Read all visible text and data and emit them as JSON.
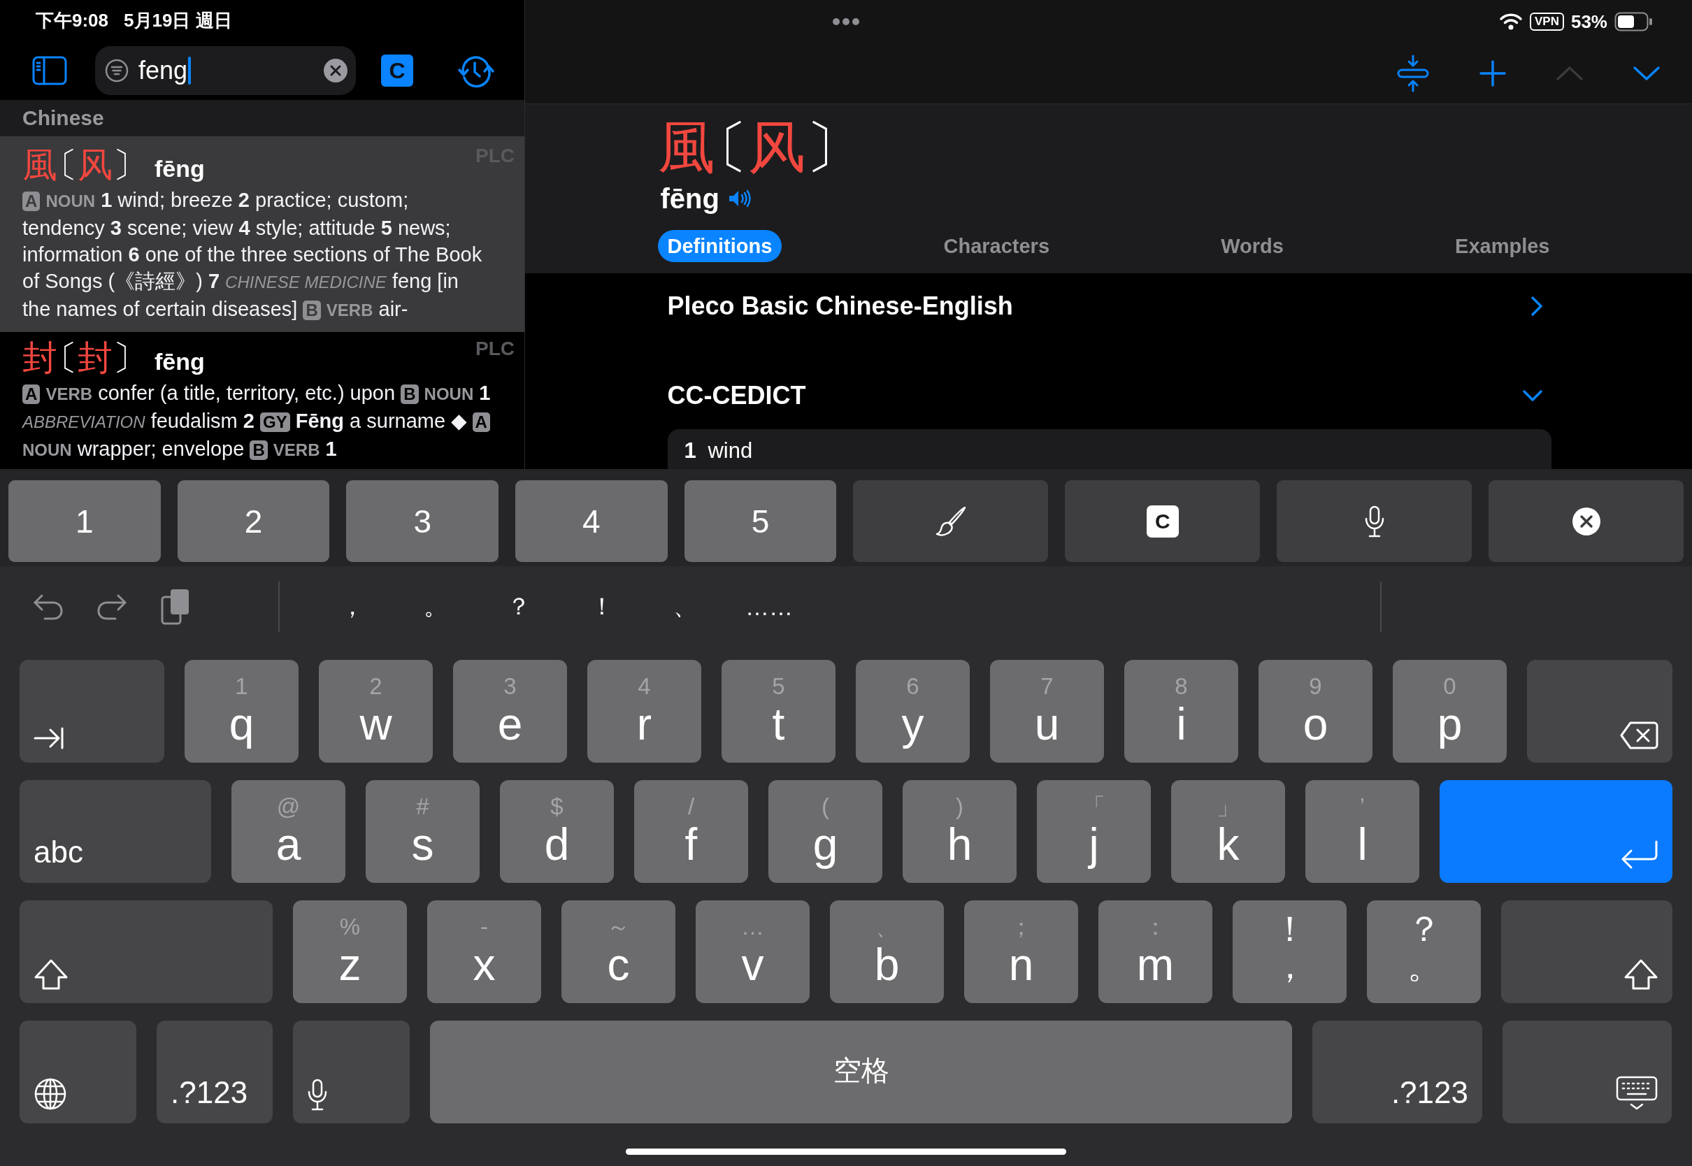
{
  "status_bar": {
    "time": "下午9:08",
    "date": "5月19日 週日",
    "vpn": "VPN",
    "battery": "53%"
  },
  "search_bar": {
    "query": "feng",
    "mode_button": "C"
  },
  "results": {
    "section": "Chinese",
    "items": [
      {
        "selected": true,
        "headword": [
          {
            "kind": "char",
            "text": "風"
          },
          {
            "kind": "bracket",
            "text": "〔"
          },
          {
            "kind": "char",
            "text": "风"
          },
          {
            "kind": "bracket",
            "text": "〕"
          }
        ],
        "pinyin": "fēng",
        "dictionary": "PLC",
        "definition": [
          {
            "kind": "badge",
            "text": "A"
          },
          {
            "kind": "pos",
            "text": "NOUN"
          },
          {
            "kind": "text",
            "text": "**1** wind; breeze **2** practice; custom; tendency **3** scene; view **4** style; attitude **5** news; information **6** one of the three sections of The Book of Songs (《詩經》) **7**"
          },
          {
            "kind": "label",
            "text": "CHINESE MEDICINE"
          },
          {
            "kind": "text",
            "text": "feng [in the names of certain diseases]"
          },
          {
            "kind": "badge",
            "text": "B"
          },
          {
            "kind": "pos",
            "text": "VERB"
          },
          {
            "kind": "text",
            "text": "air-"
          }
        ]
      },
      {
        "selected": false,
        "headword": [
          {
            "kind": "char",
            "text": "封"
          },
          {
            "kind": "bracket",
            "text": "〔"
          },
          {
            "kind": "char",
            "text": "封"
          },
          {
            "kind": "bracket",
            "text": "〕"
          }
        ],
        "pinyin": "fēng",
        "dictionary": "PLC",
        "definition": [
          {
            "kind": "badge",
            "text": "A"
          },
          {
            "kind": "pos",
            "text": "VERB"
          },
          {
            "kind": "text",
            "text": "confer (a title, territory, etc.) upon"
          },
          {
            "kind": "badge",
            "text": "B"
          },
          {
            "kind": "pos",
            "text": "NOUN"
          },
          {
            "kind": "text",
            "text": "**1**"
          },
          {
            "kind": "label",
            "text": "ABBREVIATION"
          },
          {
            "kind": "text",
            "text": "feudalism **2**"
          },
          {
            "kind": "badge",
            "text": "GY"
          },
          {
            "kind": "text",
            "text": "**Fēng** a surname ◆"
          },
          {
            "kind": "badge",
            "text": "A"
          },
          {
            "kind": "pos",
            "text": "NOUN"
          },
          {
            "kind": "text",
            "text": "wrapper; envelope"
          },
          {
            "kind": "badge",
            "text": "B"
          },
          {
            "kind": "pos",
            "text": "VERB"
          },
          {
            "kind": "text",
            "text": "**1**"
          }
        ]
      }
    ]
  },
  "entry": {
    "toolbar": [
      {
        "kind": "collapse",
        "disabled": false
      },
      {
        "kind": "add",
        "disabled": false
      },
      {
        "kind": "previous",
        "disabled": true
      },
      {
        "kind": "next",
        "disabled": false
      }
    ],
    "headword": [
      {
        "kind": "char",
        "text": "風"
      },
      {
        "kind": "bracket",
        "text": "〔"
      },
      {
        "kind": "char",
        "text": "风"
      },
      {
        "kind": "bracket",
        "text": "〕"
      }
    ],
    "pinyin": "fēng",
    "tabs": [
      {
        "label": "Definitions",
        "selected": true
      },
      {
        "label": "Characters",
        "selected": false
      },
      {
        "label": "Words",
        "selected": false
      },
      {
        "label": "Examples",
        "selected": false
      }
    ],
    "dictionaries": [
      {
        "name": "Pleco Basic Chinese-English",
        "expanded": false
      },
      {
        "name": "CC-CEDICT",
        "expanded": true,
        "senses": [
          {
            "number": "1",
            "text": "wind"
          }
        ]
      }
    ]
  },
  "input_bar": [
    {
      "kind": "digit",
      "label": "1"
    },
    {
      "kind": "digit",
      "label": "2"
    },
    {
      "kind": "digit",
      "label": "3"
    },
    {
      "kind": "digit",
      "label": "4"
    },
    {
      "kind": "digit",
      "label": "5"
    },
    {
      "kind": "handwriting"
    },
    {
      "kind": "character_mode",
      "label": "C"
    },
    {
      "kind": "voice"
    },
    {
      "kind": "clear"
    }
  ],
  "shortcut_bar": {
    "actions": [
      {
        "kind": "undo"
      },
      {
        "kind": "redo"
      },
      {
        "kind": "paste"
      }
    ],
    "punctuation": [
      "，",
      "。",
      "？",
      "！",
      "、",
      "……"
    ]
  },
  "keyboard": {
    "rows": [
      {
        "keys": [
          {
            "kind": "tab"
          },
          {
            "kind": "letter",
            "label": "q",
            "hint": "1"
          },
          {
            "kind": "letter",
            "label": "w",
            "hint": "2"
          },
          {
            "kind": "letter",
            "label": "e",
            "hint": "3"
          },
          {
            "kind": "letter",
            "label": "r",
            "hint": "4"
          },
          {
            "kind": "letter",
            "label": "t",
            "hint": "5"
          },
          {
            "kind": "letter",
            "label": "y",
            "hint": "6"
          },
          {
            "kind": "letter",
            "label": "u",
            "hint": "7"
          },
          {
            "kind": "letter",
            "label": "i",
            "hint": "8"
          },
          {
            "kind": "letter",
            "label": "o",
            "hint": "9"
          },
          {
            "kind": "letter",
            "label": "p",
            "hint": "0"
          },
          {
            "kind": "delete"
          }
        ]
      },
      {
        "keys": [
          {
            "kind": "abc",
            "label": "abc"
          },
          {
            "kind": "letter",
            "label": "a",
            "hint": "@"
          },
          {
            "kind": "letter",
            "label": "s",
            "hint": "#"
          },
          {
            "kind": "letter",
            "label": "d",
            "hint": "$"
          },
          {
            "kind": "letter",
            "label": "f",
            "hint": "/"
          },
          {
            "kind": "letter",
            "label": "g",
            "hint": "("
          },
          {
            "kind": "letter",
            "label": "h",
            "hint": ")"
          },
          {
            "kind": "letter",
            "label": "j",
            "hint": "「"
          },
          {
            "kind": "letter",
            "label": "k",
            "hint": "」"
          },
          {
            "kind": "letter",
            "label": "l",
            "hint": "’"
          },
          {
            "kind": "return"
          }
        ]
      },
      {
        "keys": [
          {
            "kind": "shift"
          },
          {
            "kind": "letter",
            "label": "z",
            "hint": "%"
          },
          {
            "kind": "letter",
            "label": "x",
            "hint": "-"
          },
          {
            "kind": "letter",
            "label": "c",
            "hint": "～"
          },
          {
            "kind": "letter",
            "label": "v",
            "hint": "…"
          },
          {
            "kind": "letter",
            "label": "b",
            "hint": "、"
          },
          {
            "kind": "letter",
            "label": "n",
            "hint": "；"
          },
          {
            "kind": "letter",
            "label": "m",
            "hint": "："
          },
          {
            "kind": "dual",
            "label": "，",
            "hint": "！"
          },
          {
            "kind": "dual",
            "label": "。",
            "hint": "？"
          },
          {
            "kind": "shift"
          }
        ]
      },
      {
        "keys": [
          {
            "kind": "globe"
          },
          {
            "kind": "symbols",
            "label": ".?123"
          },
          {
            "kind": "dictation"
          },
          {
            "kind": "space",
            "label": "空格"
          },
          {
            "kind": "symbols",
            "label": ".?123"
          },
          {
            "kind": "dismiss"
          }
        ]
      }
    ]
  }
}
